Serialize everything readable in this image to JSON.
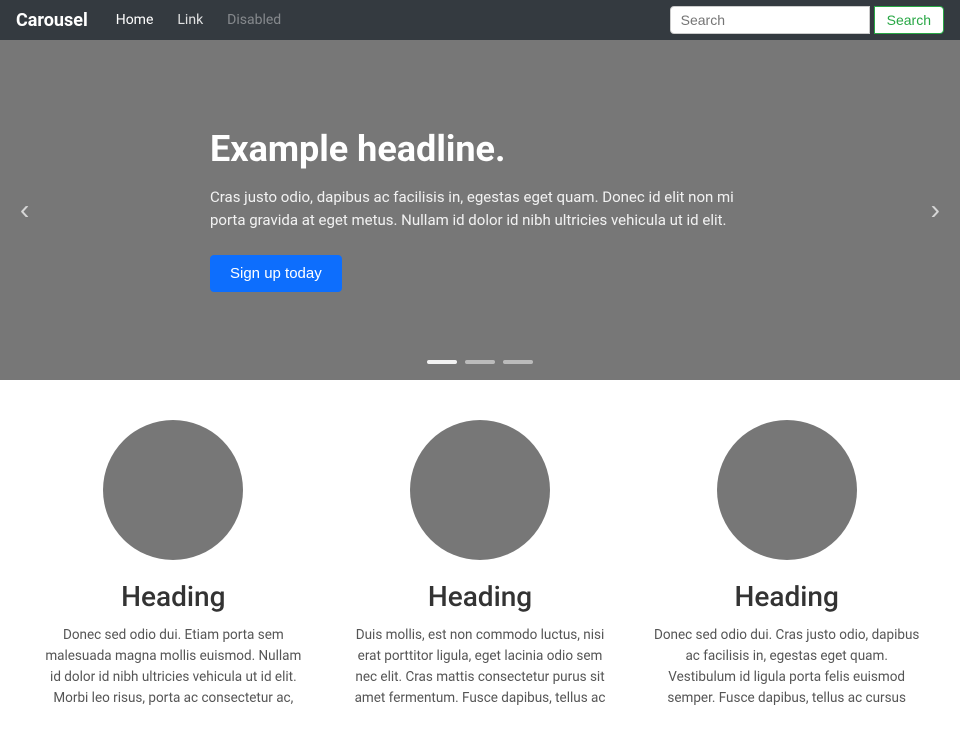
{
  "navbar": {
    "brand": "Carousel",
    "links": [
      {
        "label": "Home",
        "state": "active",
        "disabled": false
      },
      {
        "label": "Link",
        "state": "normal",
        "disabled": false
      },
      {
        "label": "Disabled",
        "state": "disabled",
        "disabled": true
      }
    ],
    "search": {
      "placeholder": "Search",
      "button_label": "Search"
    }
  },
  "carousel": {
    "prev_label": "‹",
    "next_label": "›",
    "slide": {
      "headline": "Example headline.",
      "body": "Cras justo odio, dapibus ac facilisis in, egestas eget quam. Donec id elit non mi porta gravida at eget metus. Nullam id dolor id nibh ultricies vehicula ut id elit.",
      "cta_label": "Sign up today"
    },
    "indicators": [
      {
        "active": true
      },
      {
        "active": false
      },
      {
        "active": false
      }
    ]
  },
  "columns": [
    {
      "heading": "Heading",
      "body": "Donec sed odio dui. Etiam porta sem malesuada magna mollis euismod. Nullam id dolor id nibh ultricies vehicula ut id elit. Morbi leo risus, porta ac consectetur ac,"
    },
    {
      "heading": "Heading",
      "body": "Duis mollis, est non commodo luctus, nisi erat porttitor ligula, eget lacinia odio sem nec elit. Cras mattis consectetur purus sit amet fermentum. Fusce dapibus, tellus ac"
    },
    {
      "heading": "Heading",
      "body": "Donec sed odio dui. Cras justo odio, dapibus ac facilisis in, egestas eget quam. Vestibulum id ligula porta felis euismod semper. Fusce dapibus, tellus ac cursus"
    }
  ]
}
